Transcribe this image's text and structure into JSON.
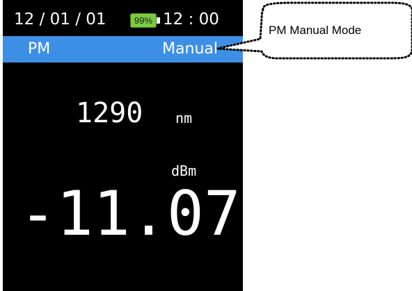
{
  "status_bar": {
    "date": "12 / 01 / 01",
    "battery_level": "99%",
    "time": "12 : 00"
  },
  "mode_bar": {
    "function": "PM",
    "mode": "Manual"
  },
  "measurement": {
    "wavelength": "1290",
    "wavelength_unit": "nm",
    "power_unit": "dBm",
    "power_value": "-11.07"
  },
  "callout": {
    "text": "PM Manual Mode"
  },
  "colors": {
    "screen_background": "#000000",
    "mode_bar": "#3d8fe6",
    "battery": "#7cc943",
    "text": "#ffffff"
  }
}
